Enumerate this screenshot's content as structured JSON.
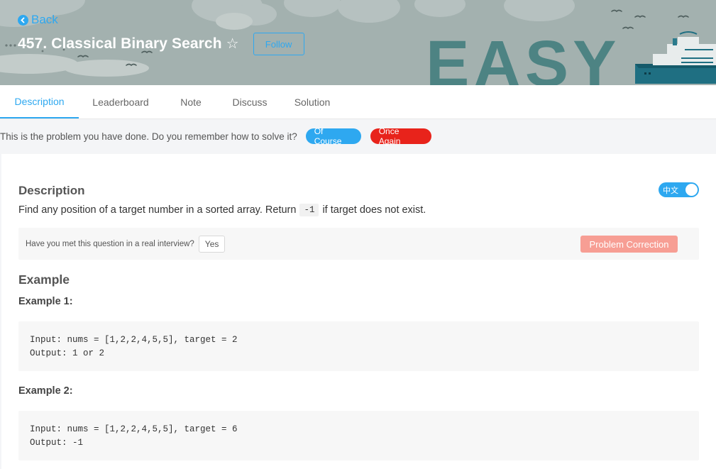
{
  "header": {
    "back_label": "Back",
    "title": "457. Classical Binary Search",
    "follow_label": "Follow",
    "difficulty_banner": "EASY"
  },
  "tabs": [
    {
      "label": "Description",
      "active": true
    },
    {
      "label": "Leaderboard",
      "active": false
    },
    {
      "label": "Note",
      "active": false
    },
    {
      "label": "Discuss",
      "active": false
    },
    {
      "label": "Solution",
      "active": false
    }
  ],
  "done_bar": {
    "message": "This is the problem you have done. Do you remember how to solve it?",
    "of_course_label": "Of Course",
    "once_again_label": "Once Again"
  },
  "description": {
    "heading": "Description",
    "text_before": "Find any position of a target number in a sorted array. Return",
    "inline_code": "-1",
    "text_after": "if target does not exist.",
    "lang_toggle_label": "中文"
  },
  "interview": {
    "question": "Have you met this question in a real interview?",
    "yes_label": "Yes",
    "correction_label": "Problem Correction"
  },
  "examples": {
    "heading": "Example",
    "items": [
      {
        "title": "Example 1:",
        "lines": [
          "Input: nums = [1,2,2,4,5,5], target = 2",
          "Output: 1 or 2"
        ]
      },
      {
        "title": "Example 2:",
        "lines": [
          "Input: nums = [1,2,2,4,5,5], target = 6",
          "Output: -1"
        ]
      }
    ]
  },
  "colors": {
    "accent": "#2ea8f0",
    "danger": "#e8231b",
    "correction": "#f79e94",
    "banner_bg": "#a3b1af"
  }
}
